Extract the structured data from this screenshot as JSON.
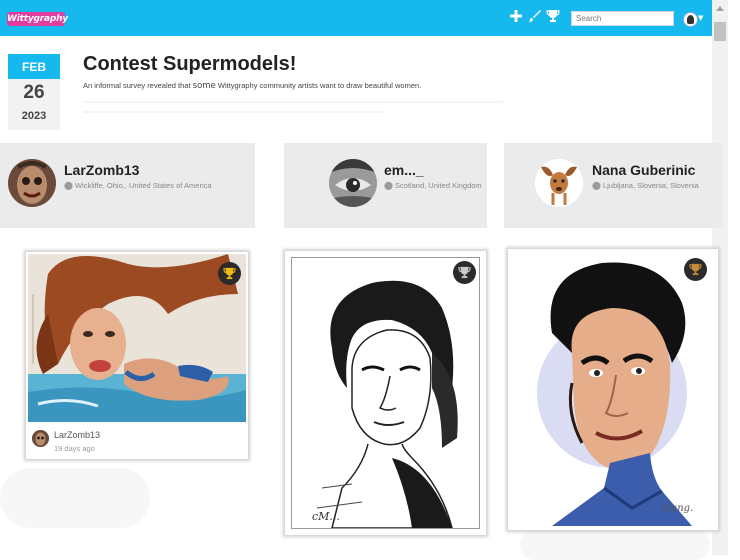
{
  "header": {
    "logo_text": "Wittygraphy",
    "search_placeholder": "Search",
    "icons": [
      "plus-icon",
      "brush-icon",
      "trophy-icon"
    ],
    "brand_color": "#16b9ee"
  },
  "contest": {
    "month": "FEB",
    "day": "26",
    "year": "2023",
    "title": "Contest Supermodels!",
    "description_before": "An informal survey revealed that ",
    "description_emphasis": "some",
    "description_after": " Wittygraphy community artists want to draw beautiful women."
  },
  "artists": [
    {
      "name": "LarZomb13",
      "location": "Wickliffe, Ohio,, United States of America"
    },
    {
      "name": "em..._",
      "location": "Scotland, United Kingdom"
    },
    {
      "name": "Nana Guberinic",
      "location": "Ljubljana, Slovenia, Slovenia"
    }
  ],
  "cards": [
    {
      "user": "LarZomb13",
      "time": "19 days ago"
    }
  ]
}
